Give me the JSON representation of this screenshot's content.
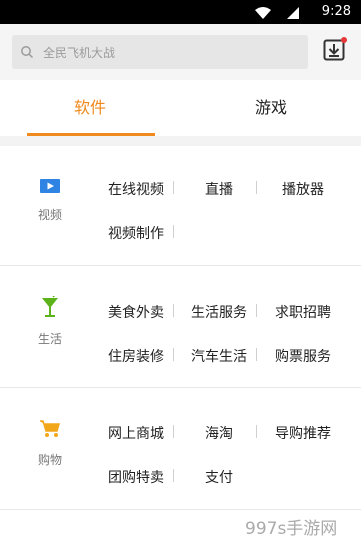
{
  "status_bar": {
    "time": "9:28"
  },
  "header": {
    "search_placeholder": "全民飞机大战"
  },
  "tabs": [
    {
      "label": "软件"
    },
    {
      "label": "游戏"
    }
  ],
  "sections": [
    {
      "category": "视频",
      "icon": "video-icon",
      "items": [
        "在线视频",
        "直播",
        "播放器",
        "视频制作"
      ]
    },
    {
      "category": "生活",
      "icon": "cocktail-icon",
      "items": [
        "美食外卖",
        "生活服务",
        "求职招聘",
        "住房装修",
        "汽车生活",
        "购票服务"
      ]
    },
    {
      "category": "购物",
      "icon": "cart-icon",
      "items": [
        "网上商城",
        "海淘",
        "导购推荐",
        "团购特卖",
        "支付"
      ]
    }
  ],
  "watermark": "997s手游网",
  "colors": {
    "accent": "#f0891e",
    "video_icon": "#2f83e2",
    "life_icon": "#5cb319",
    "shop_icon": "#f2a71b"
  }
}
